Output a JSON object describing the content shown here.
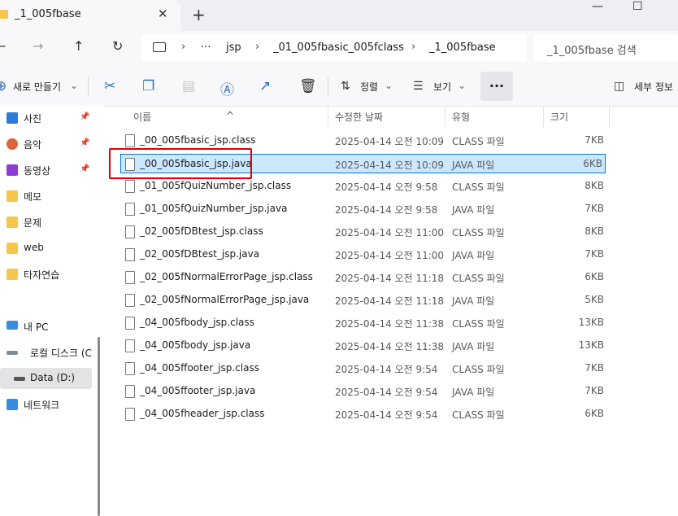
{
  "window": {
    "tab_title": "_1_005fbase",
    "tab_close": "✕",
    "new_tab": "+",
    "minimize": "—",
    "maximize": "☐"
  },
  "nav": {
    "back": "←",
    "forward": "→",
    "up": "↑",
    "refresh": "↻"
  },
  "address": {
    "more": "···",
    "crumbs": [
      "jsp",
      "_01_005fbasic_005fclass",
      "_1_005fbase"
    ],
    "separator": "›"
  },
  "search": {
    "placeholder": "_1_005fbase 검색"
  },
  "toolbar": {
    "new_label": "새로 만들기",
    "sort_label": "정렬",
    "view_label": "보기",
    "more_label": "···",
    "details_label": "세부 정보"
  },
  "sidebar": {
    "items": [
      {
        "label": "사진",
        "icon": "photos-icon",
        "pinned": true
      },
      {
        "label": "음악",
        "icon": "music-icon",
        "pinned": true
      },
      {
        "label": "동영상",
        "icon": "video-icon",
        "pinned": true
      },
      {
        "label": "메모",
        "icon": "folder-icon",
        "pinned": false
      },
      {
        "label": "문제",
        "icon": "folder-icon",
        "pinned": false
      },
      {
        "label": "web",
        "icon": "folder-icon",
        "pinned": false
      },
      {
        "label": "타자연습",
        "icon": "folder-icon",
        "pinned": false
      },
      {
        "label": "내 PC",
        "icon": "pc-icon",
        "pinned": false
      },
      {
        "label": "로컬 디스크 (C",
        "icon": "drive-icon",
        "pinned": false
      },
      {
        "label": "Data (D:)",
        "icon": "drive-icon",
        "pinned": false,
        "selected": true
      },
      {
        "label": "네트워크",
        "icon": "network-icon",
        "pinned": false
      }
    ]
  },
  "columns": {
    "name": "이름",
    "date": "수정한 날짜",
    "type": "유형",
    "size": "크기"
  },
  "files": [
    {
      "name": "_00_005fbasic_jsp.class",
      "date": "2025-04-14 오전 10:09",
      "type": "CLASS 파일",
      "size": "7KB"
    },
    {
      "name": "_00_005fbasic_jsp.java",
      "date": "2025-04-14 오전 10:09",
      "type": "JAVA 파일",
      "size": "6KB",
      "selected": true
    },
    {
      "name": "_01_005fQuizNumber_jsp.class",
      "date": "2025-04-14 오전 9:58",
      "type": "CLASS 파일",
      "size": "8KB"
    },
    {
      "name": "_01_005fQuizNumber_jsp.java",
      "date": "2025-04-14 오전 9:58",
      "type": "JAVA 파일",
      "size": "7KB"
    },
    {
      "name": "_02_005fDBtest_jsp.class",
      "date": "2025-04-14 오전 11:00",
      "type": "CLASS 파일",
      "size": "8KB"
    },
    {
      "name": "_02_005fDBtest_jsp.java",
      "date": "2025-04-14 오전 11:00",
      "type": "JAVA 파일",
      "size": "7KB"
    },
    {
      "name": "_02_005fNormalErrorPage_jsp.class",
      "date": "2025-04-14 오전 11:18",
      "type": "CLASS 파일",
      "size": "6KB"
    },
    {
      "name": "_02_005fNormalErrorPage_jsp.java",
      "date": "2025-04-14 오전 11:18",
      "type": "JAVA 파일",
      "size": "5KB"
    },
    {
      "name": "_04_005fbody_jsp.class",
      "date": "2025-04-14 오전 11:38",
      "type": "CLASS 파일",
      "size": "13KB"
    },
    {
      "name": "_04_005fbody_jsp.java",
      "date": "2025-04-14 오전 11:38",
      "type": "JAVA 파일",
      "size": "13KB"
    },
    {
      "name": "_04_005ffooter_jsp.class",
      "date": "2025-04-14 오전 9:54",
      "type": "CLASS 파일",
      "size": "7KB"
    },
    {
      "name": "_04_005ffooter_jsp.java",
      "date": "2025-04-14 오전 9:54",
      "type": "JAVA 파일",
      "size": "7KB"
    },
    {
      "name": "_04_005fheader_jsp.class",
      "date": "2025-04-14 오전 9:54",
      "type": "CLASS 파일",
      "size": "6KB"
    }
  ],
  "colors": {
    "selection": "#cce8ff",
    "selection_border": "#0078d4",
    "highlight_box": "#e00000",
    "folder": "#f6c64c"
  }
}
